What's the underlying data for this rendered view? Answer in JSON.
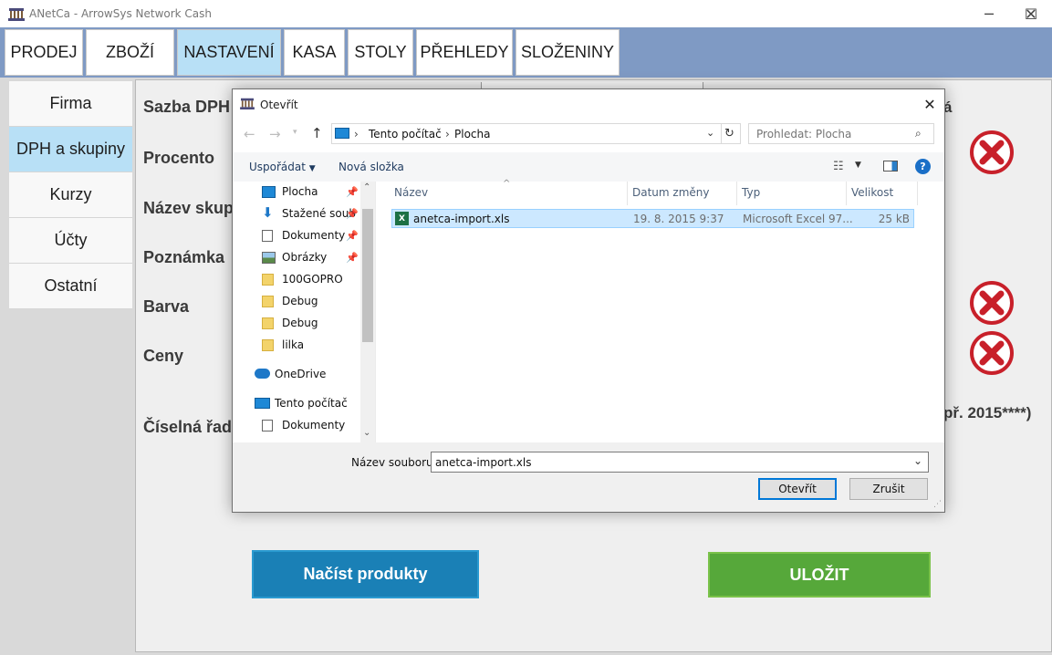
{
  "window": {
    "title": "ANetCa - ArrowSys Network Cash",
    "minimize_glyph": "─",
    "maximize_glyph": "☐",
    "close_glyph": "✕"
  },
  "main_tabs": [
    {
      "label": "PRODEJ",
      "active": false
    },
    {
      "label": "ZBOŽÍ",
      "active": false
    },
    {
      "label": "NASTAVENÍ",
      "active": true
    },
    {
      "label": "KASA",
      "active": false
    },
    {
      "label": "STOLY",
      "active": false
    },
    {
      "label": "PŘEHLEDY",
      "active": false
    },
    {
      "label": "SLOŽENINY",
      "active": false
    }
  ],
  "side_nav": [
    {
      "label": "Firma",
      "active": false
    },
    {
      "label": "DPH a skupiny",
      "active": true
    },
    {
      "label": "Kurzy",
      "active": false
    },
    {
      "label": "Účty",
      "active": false
    },
    {
      "label": "Ostatní",
      "active": false
    }
  ],
  "form": {
    "labels": [
      "Sazba DPH",
      "Procento",
      "Název skupi",
      "Poznámka",
      "Barva",
      "Ceny",
      "Číselná řada"
    ],
    "right_fragment_1": "á",
    "right_fragment_2": "př. 2015****)",
    "load_button": "Načíst produkty",
    "save_button": "ULOŽIT"
  },
  "dialog": {
    "title": "Otevřít",
    "close_glyph": "✕",
    "breadcrumb": [
      "Tento počítač",
      "Plocha"
    ],
    "breadcrumb_sep": "›",
    "refresh_glyph": "↻",
    "search_placeholder": "Prohledat: Plocha",
    "organize_label": "Uspořádat",
    "new_folder_label": "Nová složka",
    "help_glyph": "?",
    "nav_items": [
      {
        "label": "Plocha",
        "icon": "desktop-icon",
        "pinned": true
      },
      {
        "label": "Stažené soub",
        "icon": "download-icon",
        "pinned": true
      },
      {
        "label": "Dokumenty",
        "icon": "documents-icon",
        "pinned": true
      },
      {
        "label": "Obrázky",
        "icon": "pictures-icon",
        "pinned": true
      },
      {
        "label": "100GOPRO",
        "icon": "folder-icon",
        "pinned": false
      },
      {
        "label": "Debug",
        "icon": "folder-icon",
        "pinned": false
      },
      {
        "label": "Debug",
        "icon": "folder-icon",
        "pinned": false
      },
      {
        "label": "lilka",
        "icon": "folder-icon",
        "pinned": false
      },
      {
        "label": "OneDrive",
        "icon": "onedrive-icon",
        "pinned": false
      },
      {
        "label": "Tento počítač",
        "icon": "computer-icon",
        "pinned": false
      },
      {
        "label": "Dokumenty",
        "icon": "documents-icon",
        "pinned": false
      }
    ],
    "columns": [
      "Název",
      "Datum změny",
      "Typ",
      "Velikost"
    ],
    "files": [
      {
        "name": "anetca-import.xls",
        "modified": "19. 8. 2015 9:37",
        "type": "Microsoft Excel 97...",
        "size": "25 kB"
      }
    ],
    "filename_label": "Název souboru:",
    "filename_value": "anetca-import.xls",
    "open_button": "Otevřít",
    "cancel_button": "Zrušit"
  },
  "colors": {
    "tab_bar": "#7f9ac4",
    "active_tab": "#b8e0f6",
    "load_button": "#1a80b6",
    "save_button": "#56a83a",
    "delete_icon": "#c8202a",
    "selected_file_row": "#cce8ff"
  }
}
